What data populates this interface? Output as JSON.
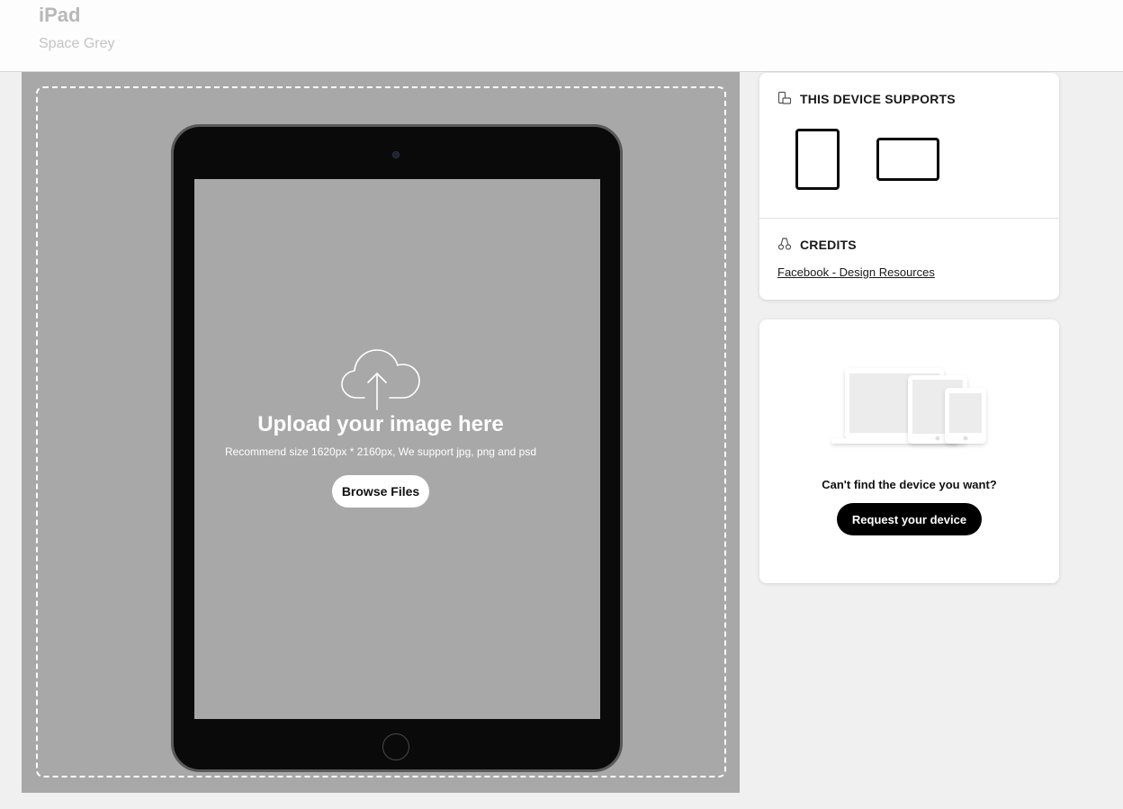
{
  "header": {
    "title": "iPad",
    "subtitle": "Space Grey"
  },
  "upload": {
    "heading": "Upload your image here",
    "hint": "Recommend size 1620px * 2160px, We support jpg, png and psd",
    "browse_label": "Browse Files"
  },
  "supports": {
    "title": "THIS DEVICE SUPPORTS"
  },
  "credits": {
    "title": "CREDITS",
    "link_text": "Facebook - Design Resources"
  },
  "request": {
    "question": "Can't find the device you want?",
    "button_label": "Request your device"
  },
  "colors": {
    "page_background": "#f0f0f0",
    "mockup_background": "#a8a8a8",
    "device_frame": "#0a0a0a",
    "button_dark": "#000000"
  },
  "icons": {
    "upload": "cloud-upload-icon",
    "supports": "devices-icon",
    "credits": "credits-icon"
  }
}
